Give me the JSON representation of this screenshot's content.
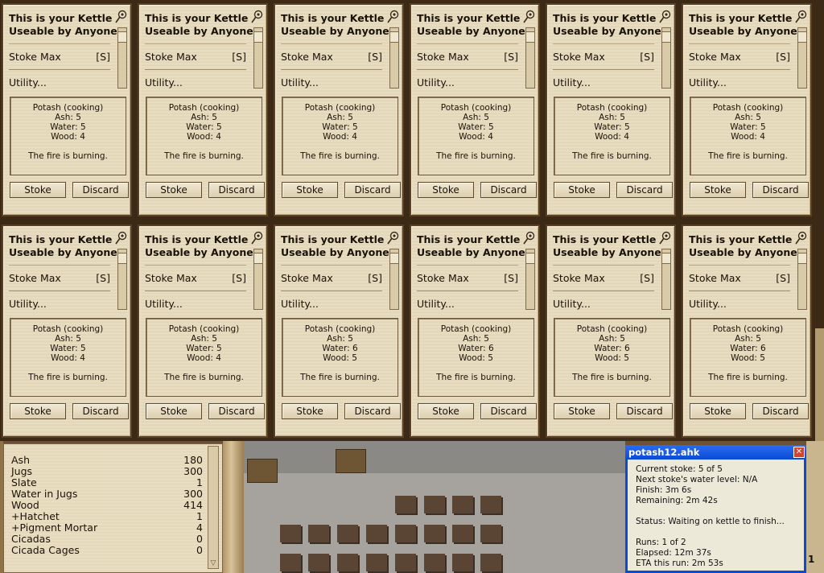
{
  "kettles": [
    {
      "title1": "This is your Kettle",
      "title2": "Useable by Anyone",
      "stoke_label": "Stoke Max",
      "stoke_key": "[S]",
      "utility": "Utility...",
      "recipe": "Potash (cooking)",
      "ash": "Ash: 5",
      "water": "Water: 5",
      "wood": "Wood: 4",
      "status": "The fire is burning.",
      "stoke_btn": "Stoke",
      "discard_btn": "Discard"
    },
    {
      "title1": "This is your Kettle",
      "title2": "Useable by Anyone",
      "stoke_label": "Stoke Max",
      "stoke_key": "[S]",
      "utility": "Utility...",
      "recipe": "Potash (cooking)",
      "ash": "Ash: 5",
      "water": "Water: 5",
      "wood": "Wood: 4",
      "status": "The fire is burning.",
      "stoke_btn": "Stoke",
      "discard_btn": "Discard"
    },
    {
      "title1": "This is your Kettle",
      "title2": "Useable by Anyone",
      "stoke_label": "Stoke Max",
      "stoke_key": "[S]",
      "utility": "Utility...",
      "recipe": "Potash (cooking)",
      "ash": "Ash: 5",
      "water": "Water: 5",
      "wood": "Wood: 4",
      "status": "The fire is burning.",
      "stoke_btn": "Stoke",
      "discard_btn": "Discard"
    },
    {
      "title1": "This is your Kettle",
      "title2": "Useable by Anyone",
      "stoke_label": "Stoke Max",
      "stoke_key": "[S]",
      "utility": "Utility...",
      "recipe": "Potash (cooking)",
      "ash": "Ash: 5",
      "water": "Water: 5",
      "wood": "Wood: 4",
      "status": "The fire is burning.",
      "stoke_btn": "Stoke",
      "discard_btn": "Discard"
    },
    {
      "title1": "This is your Kettle",
      "title2": "Useable by Anyone",
      "stoke_label": "Stoke Max",
      "stoke_key": "[S]",
      "utility": "Utility...",
      "recipe": "Potash (cooking)",
      "ash": "Ash: 5",
      "water": "Water: 5",
      "wood": "Wood: 4",
      "status": "The fire is burning.",
      "stoke_btn": "Stoke",
      "discard_btn": "Discard"
    },
    {
      "title1": "This is your Kettle",
      "title2": "Useable by Anyone",
      "stoke_label": "Stoke Max",
      "stoke_key": "[S]",
      "utility": "Utility...",
      "recipe": "Potash (cooking)",
      "ash": "Ash: 5",
      "water": "Water: 5",
      "wood": "Wood: 4",
      "status": "The fire is burning.",
      "stoke_btn": "Stoke",
      "discard_btn": "Discard"
    },
    {
      "title1": "This is your Kettle",
      "title2": "Useable by Anyone",
      "stoke_label": "Stoke Max",
      "stoke_key": "[S]",
      "utility": "Utility...",
      "recipe": "Potash (cooking)",
      "ash": "Ash: 5",
      "water": "Water: 5",
      "wood": "Wood: 4",
      "status": "The fire is burning.",
      "stoke_btn": "Stoke",
      "discard_btn": "Discard"
    },
    {
      "title1": "This is your Kettle",
      "title2": "Useable by Anyone",
      "stoke_label": "Stoke Max",
      "stoke_key": "[S]",
      "utility": "Utility...",
      "recipe": "Potash (cooking)",
      "ash": "Ash: 5",
      "water": "Water: 5",
      "wood": "Wood: 4",
      "status": "The fire is burning.",
      "stoke_btn": "Stoke",
      "discard_btn": "Discard"
    },
    {
      "title1": "This is your Kettle",
      "title2": "Useable by Anyone",
      "stoke_label": "Stoke Max",
      "stoke_key": "[S]",
      "utility": "Utility...",
      "recipe": "Potash (cooking)",
      "ash": "Ash: 5",
      "water": "Water: 6",
      "wood": "Wood: 5",
      "status": "The fire is burning.",
      "stoke_btn": "Stoke",
      "discard_btn": "Discard"
    },
    {
      "title1": "This is your Kettle",
      "title2": "Useable by Anyone",
      "stoke_label": "Stoke Max",
      "stoke_key": "[S]",
      "utility": "Utility...",
      "recipe": "Potash (cooking)",
      "ash": "Ash: 5",
      "water": "Water: 6",
      "wood": "Wood: 5",
      "status": "The fire is burning.",
      "stoke_btn": "Stoke",
      "discard_btn": "Discard"
    },
    {
      "title1": "This is your Kettle",
      "title2": "Useable by Anyone",
      "stoke_label": "Stoke Max",
      "stoke_key": "[S]",
      "utility": "Utility...",
      "recipe": "Potash (cooking)",
      "ash": "Ash: 5",
      "water": "Water: 6",
      "wood": "Wood: 5",
      "status": "The fire is burning.",
      "stoke_btn": "Stoke",
      "discard_btn": "Discard"
    },
    {
      "title1": "This is your Kettle",
      "title2": "Useable by Anyone",
      "stoke_label": "Stoke Max",
      "stoke_key": "[S]",
      "utility": "Utility...",
      "recipe": "Potash (cooking)",
      "ash": "Ash: 5",
      "water": "Water: 6",
      "wood": "Wood: 5",
      "status": "The fire is burning.",
      "stoke_btn": "Stoke",
      "discard_btn": "Discard"
    }
  ],
  "inventory": [
    {
      "name": "Ash",
      "value": "180"
    },
    {
      "name": "Jugs",
      "value": "300"
    },
    {
      "name": "Slate",
      "value": "1"
    },
    {
      "name": "Water in Jugs",
      "value": "300"
    },
    {
      "name": "Wood",
      "value": "414"
    },
    {
      "name": "+Hatchet",
      "value": "1"
    },
    {
      "name": "+Pigment Mortar",
      "value": "4"
    },
    {
      "name": "Cicadas",
      "value": "0"
    },
    {
      "name": "Cicada Cages",
      "value": "0"
    }
  ],
  "ahk": {
    "title": "potash12.ahk",
    "close": "✕",
    "current_stoke": "Current stoke: 5 of 5",
    "next_water": "Next stoke's water level: N/A",
    "finish": "Finish: 3m 6s",
    "remaining": "Remaining: 2m 42s",
    "status": "Status: Waiting on kettle to finish...",
    "runs": "Runs: 1 of 2",
    "elapsed": "Elapsed: 12m 37s",
    "eta": "ETA this run: 2m 53s"
  },
  "right_edge_number": "1",
  "icons": {
    "pin": "pushpin-icon",
    "down": "scroll-down-arrow-icon"
  }
}
